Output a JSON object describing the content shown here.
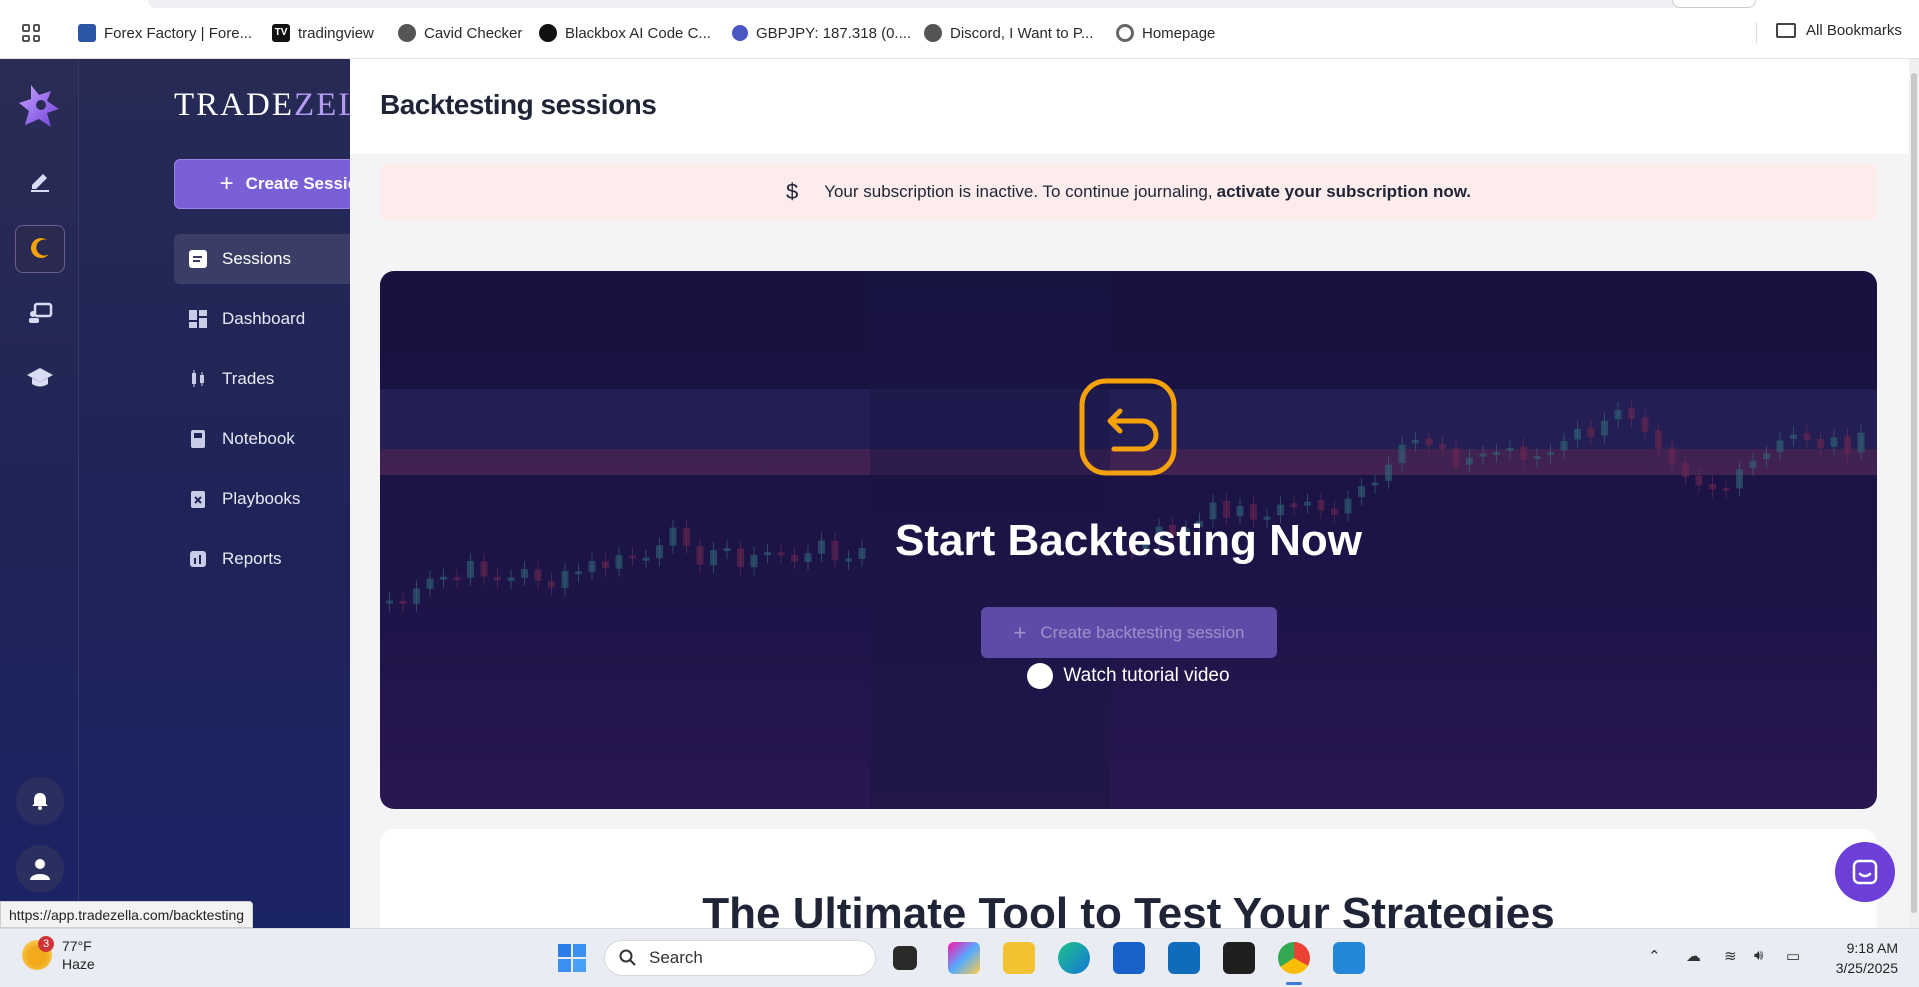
{
  "bookmarks": {
    "items": [
      {
        "label": "Forex Factory | Fore...",
        "icon": "forex-factory-icon"
      },
      {
        "label": "tradingview",
        "icon": "tradingview-icon"
      },
      {
        "label": "Cavid Checker",
        "icon": "globe-icon"
      },
      {
        "label": "Blackbox AI Code C...",
        "icon": "blackbox-icon"
      },
      {
        "label": "GBPJPY: 187.318 (0....",
        "icon": "chart-icon"
      },
      {
        "label": "Discord, I Want to P...",
        "icon": "globe-icon"
      },
      {
        "label": "Homepage",
        "icon": "homepage-icon"
      }
    ],
    "all_bookmarks": "All Bookmarks"
  },
  "sidebar": {
    "brand_prefix": "TRADE",
    "brand_suffix": "ZELLA",
    "create_label": "Create Session",
    "items": [
      {
        "label": "Sessions",
        "icon": "sessions-icon",
        "active": true
      },
      {
        "label": "Dashboard",
        "icon": "dashboard-icon",
        "active": false
      },
      {
        "label": "Trades",
        "icon": "trades-icon",
        "active": false
      },
      {
        "label": "Notebook",
        "icon": "notebook-icon",
        "active": false
      },
      {
        "label": "Playbooks",
        "icon": "playbooks-icon",
        "active": false
      },
      {
        "label": "Reports",
        "icon": "reports-icon",
        "active": false
      }
    ]
  },
  "status_url": "https://app.tradezella.com/backtesting",
  "main": {
    "title": "Backtesting sessions",
    "alert": {
      "text": "Your subscription is inactive. To continue journaling,",
      "link": "activate your subscription now."
    },
    "hero": {
      "title": "Start Backtesting Now",
      "button": "Create backtesting session",
      "watch": "Watch tutorial video"
    },
    "section_title": "The Ultimate Tool to Test Your Strategies"
  },
  "taskbar": {
    "weather_temp": "77°F",
    "weather_desc": "Haze",
    "weather_badge": "3",
    "search_placeholder": "Search",
    "time": "9:18 AM",
    "date": "3/25/2025"
  },
  "colors": {
    "accent": "#7b5fd6",
    "sidebar": "#1e2358",
    "hero_icon": "#f5a10a",
    "alert_bg": "#fcecec"
  }
}
